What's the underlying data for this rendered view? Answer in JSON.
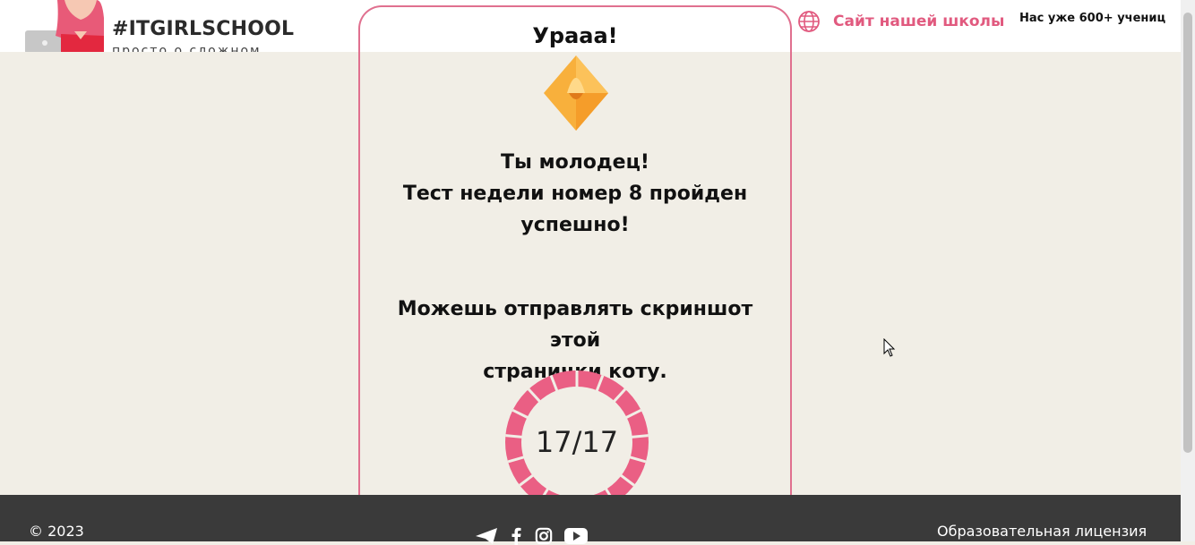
{
  "header": {
    "logo_title": "#ITGIRLSCHOOL",
    "logo_subtitle": "просто о сложном",
    "site_link": "Сайт нашей школы",
    "students_count": "Нас уже 600+ учениц"
  },
  "card": {
    "title": "Урааа!",
    "line1": "Ты молодец!",
    "line2": "Тест недели номер 8 пройден",
    "line3": "успешно!",
    "line4": "Можешь отправлять скриншот этой",
    "line5": "странички коту.",
    "score": "17/17"
  },
  "footer": {
    "copyright": "© 2023",
    "license": "Образовательная лицензия"
  },
  "colors": {
    "accent": "#e15a7f",
    "background": "#f1eee6",
    "footer": "#3a3a3a"
  }
}
